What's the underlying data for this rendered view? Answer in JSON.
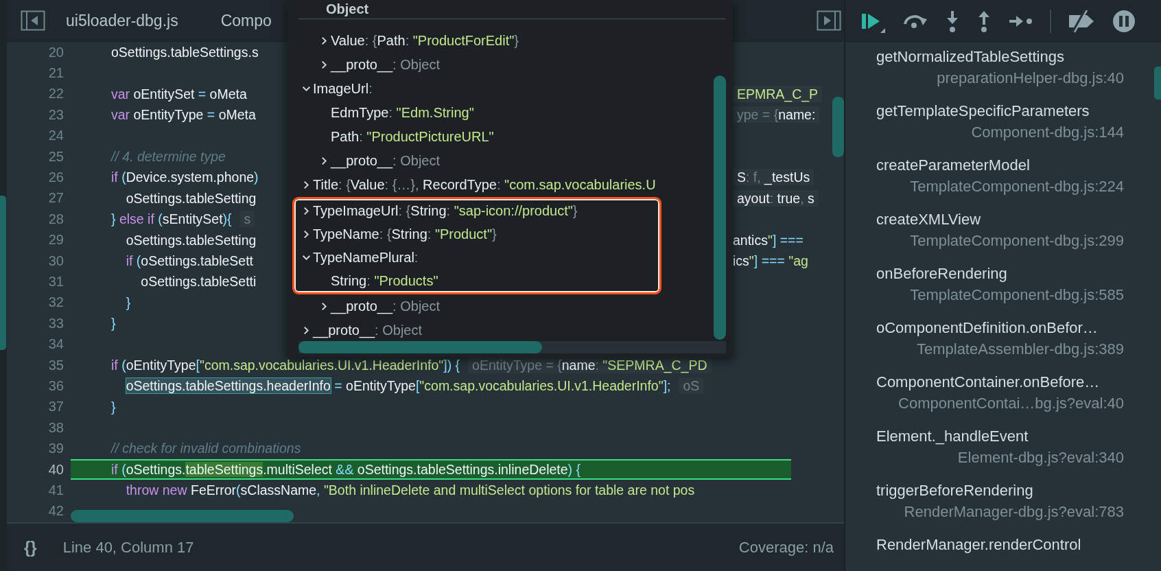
{
  "tabs": [
    {
      "label": "ui5loader-dbg.js"
    },
    {
      "label": "Compo"
    }
  ],
  "editor": {
    "lines": [
      {
        "number": "20",
        "current": false,
        "code": [
          {
            "kind": "identifier",
            "text": "oSettings.tableSettings.s"
          }
        ]
      },
      {
        "number": "21",
        "current": false
      },
      {
        "number": "22",
        "current": false,
        "code": [
          {
            "kind": "keyword",
            "text": "var"
          },
          {
            "kind": "identifier",
            "text": " oEntitySet "
          },
          {
            "kind": "operator",
            "text": "="
          },
          {
            "kind": "identifier",
            "text": " oMeta"
          }
        ],
        "after_popup": [
          {
            "kind": "hint",
            "parts": [
              {
                "kind": "string",
                "text": "EPMRA_C_P"
              }
            ]
          }
        ]
      },
      {
        "number": "23",
        "current": false,
        "code": [
          {
            "kind": "keyword",
            "text": "var"
          },
          {
            "kind": "identifier",
            "text": " oEntityType "
          },
          {
            "kind": "operator",
            "text": "="
          },
          {
            "kind": "identifier",
            "text": " oMeta"
          }
        ],
        "after_popup": [
          {
            "kind": "hint",
            "parts": [
              {
                "kind": "dim",
                "text": "ype = {"
              },
              {
                "kind": "identifier",
                "text": "name:"
              }
            ]
          }
        ]
      },
      {
        "number": "24",
        "current": false
      },
      {
        "number": "25",
        "current": false,
        "code": [
          {
            "kind": "comment",
            "text": "// 4. determine type"
          }
        ]
      },
      {
        "number": "26",
        "current": false,
        "code": [
          {
            "kind": "keyword",
            "text": "if"
          },
          {
            "kind": "punctuation",
            "text": " ("
          },
          {
            "kind": "identifier",
            "text": "Device.system.phone"
          },
          {
            "kind": "punctuation",
            "text": ")"
          }
        ],
        "after_popup": [
          {
            "kind": "hint",
            "parts": [
              {
                "kind": "identifier",
                "text": "S"
              },
              {
                "kind": "dim",
                "text": ": f, "
              },
              {
                "kind": "identifier",
                "text": "_testUs"
              }
            ]
          }
        ]
      },
      {
        "number": "27",
        "current": false,
        "code": [
          {
            "kind": "identifier",
            "text": "    oSettings.tableSetting"
          }
        ],
        "after_popup": [
          {
            "kind": "hint",
            "parts": [
              {
                "kind": "identifier",
                "text": "ayout"
              },
              {
                "kind": "dim",
                "text": ": "
              },
              {
                "kind": "identifier",
                "text": "true"
              },
              {
                "kind": "dim",
                "text": ", "
              },
              {
                "kind": "identifier",
                "text": "s"
              }
            ]
          }
        ]
      },
      {
        "number": "28",
        "current": false,
        "code": [
          {
            "kind": "punctuation",
            "text": "}"
          },
          {
            "kind": "keyword",
            "text": " else if"
          },
          {
            "kind": "punctuation",
            "text": " ("
          },
          {
            "kind": "identifier",
            "text": "sEntitySet"
          },
          {
            "kind": "punctuation",
            "text": "){"
          },
          {
            "kind": "hint",
            "parts": [
              {
                "kind": "dim",
                "text": "s"
              }
            ]
          }
        ]
      },
      {
        "number": "29",
        "current": false,
        "code": [
          {
            "kind": "identifier",
            "text": "    oSettings.tableSetting"
          }
        ],
        "after_popup": [
          {
            "kind": "identifier",
            "text": "antics"
          },
          {
            "kind": "string",
            "text": "\""
          },
          {
            "kind": "punctuation",
            "text": "] "
          },
          {
            "kind": "operator",
            "text": "==="
          }
        ]
      },
      {
        "number": "30",
        "current": false,
        "code": [
          {
            "kind": "keyword",
            "text": "    if"
          },
          {
            "kind": "punctuation",
            "text": " ("
          },
          {
            "kind": "identifier",
            "text": "oSettings.tableSett"
          }
        ],
        "after_popup": [
          {
            "kind": "identifier",
            "text": "ics"
          },
          {
            "kind": "string",
            "text": "\""
          },
          {
            "kind": "punctuation",
            "text": "] "
          },
          {
            "kind": "operator",
            "text": "=== "
          },
          {
            "kind": "string",
            "text": "\"ag"
          }
        ]
      },
      {
        "number": "31",
        "current": false,
        "code": [
          {
            "kind": "identifier",
            "text": "        oSettings.tableSetti"
          }
        ]
      },
      {
        "number": "32",
        "current": false,
        "code": [
          {
            "kind": "punctuation",
            "text": "    }"
          }
        ]
      },
      {
        "number": "33",
        "current": false,
        "code": [
          {
            "kind": "punctuation",
            "text": "}"
          }
        ]
      },
      {
        "number": "34",
        "current": false
      },
      {
        "number": "35",
        "current": false,
        "code": [
          {
            "kind": "keyword",
            "text": "if"
          },
          {
            "kind": "punctuation",
            "text": " ("
          },
          {
            "kind": "identifier",
            "text": "oEntityType"
          },
          {
            "kind": "punctuation",
            "text": "["
          },
          {
            "kind": "string",
            "text": "\"com.sap.vocabularies.UI.v1.HeaderInfo\""
          },
          {
            "kind": "punctuation",
            "text": "]) {"
          },
          {
            "kind": "hint",
            "parts": [
              {
                "kind": "dim",
                "text": "oEntityType = {"
              },
              {
                "kind": "identifier",
                "text": "name"
              },
              {
                "kind": "dim",
                "text": ": "
              },
              {
                "kind": "string",
                "text": "\"SEPMRA_C_PD"
              }
            ]
          }
        ]
      },
      {
        "number": "36",
        "current": false,
        "code": [
          {
            "kind": "selection",
            "text": "    oSettings.tableSettings.headerInfo"
          },
          {
            "kind": "operator",
            "text": " ="
          },
          {
            "kind": "identifier",
            "text": " oEntityType"
          },
          {
            "kind": "punctuation",
            "text": "["
          },
          {
            "kind": "string",
            "text": "\"com.sap.vocabularies.UI.v1.HeaderInfo\""
          },
          {
            "kind": "punctuation",
            "text": "];"
          },
          {
            "kind": "hint",
            "parts": [
              {
                "kind": "dim",
                "text": "oS"
              }
            ]
          }
        ]
      },
      {
        "number": "37",
        "current": false,
        "code": [
          {
            "kind": "punctuation",
            "text": "}"
          }
        ]
      },
      {
        "number": "38",
        "current": false
      },
      {
        "number": "39",
        "current": false,
        "code": [
          {
            "kind": "comment",
            "text": "// check for invalid combinations"
          }
        ]
      },
      {
        "number": "40",
        "current": true,
        "code": [
          {
            "kind": "keyword",
            "text": "if"
          },
          {
            "kind": "punctuation",
            "text": " ("
          },
          {
            "kind": "identifier",
            "text": "oSettings."
          },
          {
            "kind": "match",
            "text": "tableSettings"
          },
          {
            "kind": "identifier",
            "text": ".multiSelect"
          },
          {
            "kind": "operator",
            "text": " &&"
          },
          {
            "kind": "identifier",
            "text": " oSettings.tableSettings.inlineDelete"
          },
          {
            "kind": "punctuation",
            "text": ") {"
          }
        ]
      },
      {
        "number": "41",
        "current": false,
        "code": [
          {
            "kind": "keyword",
            "text": "    throw new"
          },
          {
            "kind": "identifier",
            "text": " FeError"
          },
          {
            "kind": "punctuation",
            "text": "("
          },
          {
            "kind": "identifier",
            "text": "sClassName"
          },
          {
            "kind": "punctuation",
            "text": ", "
          },
          {
            "kind": "string",
            "text": "\"Both inlineDelete and multiSelect options for table are not pos"
          }
        ]
      },
      {
        "number": "42",
        "current": false
      }
    ]
  },
  "object_popup": {
    "title": "Object",
    "properties": [
      {
        "children": [
          {
            "text": "Value: {Path: \"ProductForEdit\"}",
            "expanded": false,
            "highlighted": false
          },
          {
            "text": "__proto__: Object",
            "expanded": false,
            "highlighted": false
          }
        ]
      },
      {
        "text": "ImageUrl:",
        "expanded": true,
        "highlighted": false,
        "children": [
          {
            "text": "EdmType: \"Edm.String\"",
            "highlighted": false
          },
          {
            "text": "Path: \"ProductPictureURL\"",
            "highlighted": false
          },
          {
            "text": "__proto__: Object",
            "expanded": false,
            "highlighted": false
          }
        ]
      },
      {
        "text": "Title: {Value: {…}, RecordType: \"com.sap.vocabularies.U",
        "expanded": false,
        "highlighted": false
      },
      {
        "text": "TypeImageUrl: {String: \"sap-icon://product\"}",
        "expanded": false,
        "highlighted": true
      },
      {
        "text": "TypeName: {String: \"Product\"}",
        "expanded": false,
        "highlighted": true
      },
      {
        "text": "TypeNamePlural:",
        "expanded": true,
        "highlighted": true,
        "children": [
          {
            "text": "String: \"Products\"",
            "highlighted": true
          },
          {
            "text": "__proto__: Object",
            "expanded": false,
            "highlighted": false
          }
        ]
      },
      {
        "text": "__proto__: Object",
        "expanded": false,
        "highlighted": false
      }
    ]
  },
  "status_bar": {
    "format_button": "{}",
    "position": "Line 40, Column 17",
    "coverage": "Coverage: n/a"
  },
  "call_stack": [
    {
      "function": "getNormalizedTableSettings",
      "location": "preparationHelper-dbg.js:40"
    },
    {
      "function": "getTemplateSpecificParameters",
      "location": "Component-dbg.js:144"
    },
    {
      "function": "createParameterModel",
      "location": "TemplateComponent-dbg.js:224"
    },
    {
      "function": "createXMLView",
      "location": "TemplateComponent-dbg.js:299"
    },
    {
      "function": "onBeforeRendering",
      "location": "TemplateComponent-dbg.js:585"
    },
    {
      "function": "oComponentDefinition.onBefor…",
      "location": "TemplateAssembler-dbg.js:389"
    },
    {
      "function": "ComponentContainer.onBefore…",
      "location": "ComponentContai…bg.js?eval:40"
    },
    {
      "function": "Element._handleEvent",
      "location": "Element-dbg.js?eval:340"
    },
    {
      "function": "triggerBeforeRendering",
      "location": "RenderManager-dbg.js?eval:783"
    },
    {
      "function": "RenderManager.renderControl"
    }
  ]
}
